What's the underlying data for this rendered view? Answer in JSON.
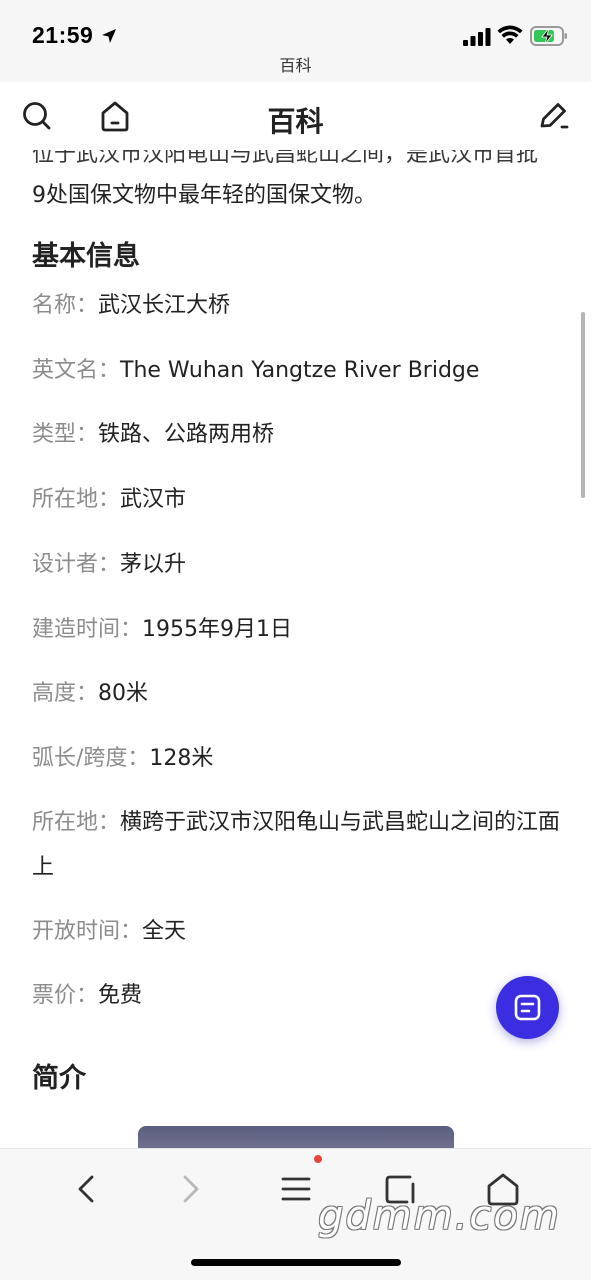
{
  "status_bar": {
    "time": "21:59",
    "url": "百科"
  },
  "header": {
    "title": "百科"
  },
  "article": {
    "cut_line": "位于武汉市汉阳龟山与武昌蛇山之间，是武汉市首批",
    "intro_tail": "9处国保文物中最年轻的国保文物。",
    "basic_info_title": "基本信息",
    "info": [
      {
        "label": "名称：",
        "value": "武汉长江大桥"
      },
      {
        "label": "英文名：",
        "value": "The Wuhan Yangtze River Bridge"
      },
      {
        "label": "类型：",
        "value": "铁路、公路两用桥"
      },
      {
        "label": "所在地：",
        "value": "武汉市"
      },
      {
        "label": "设计者：",
        "value": "茅以升"
      },
      {
        "label": "建造时间：",
        "value": "1955年9月1日"
      },
      {
        "label": "高度：",
        "value": "80米"
      },
      {
        "label": "弧长/跨度：",
        "value": "128米"
      },
      {
        "label": "所在地：",
        "value": "横跨于武汉市汉阳龟山与武昌蛇山之间的江面上"
      },
      {
        "label": "开放时间：",
        "value": "全天"
      },
      {
        "label": "票价：",
        "value": "免费"
      }
    ],
    "intro_title": "简介"
  },
  "toolbar": {
    "watermark": "gdmm.com"
  },
  "colors": {
    "fab": "#3a2ee0",
    "label_gray": "#8c8c8c",
    "notify_dot": "#e8453c"
  },
  "icons": [
    "location-arrow-icon",
    "signal-icon",
    "wifi-icon",
    "battery-charging-icon",
    "search-icon",
    "home-icon",
    "edit-icon",
    "notes-icon",
    "back-icon",
    "forward-icon",
    "menu-icon",
    "tabs-icon",
    "home-icon"
  ]
}
